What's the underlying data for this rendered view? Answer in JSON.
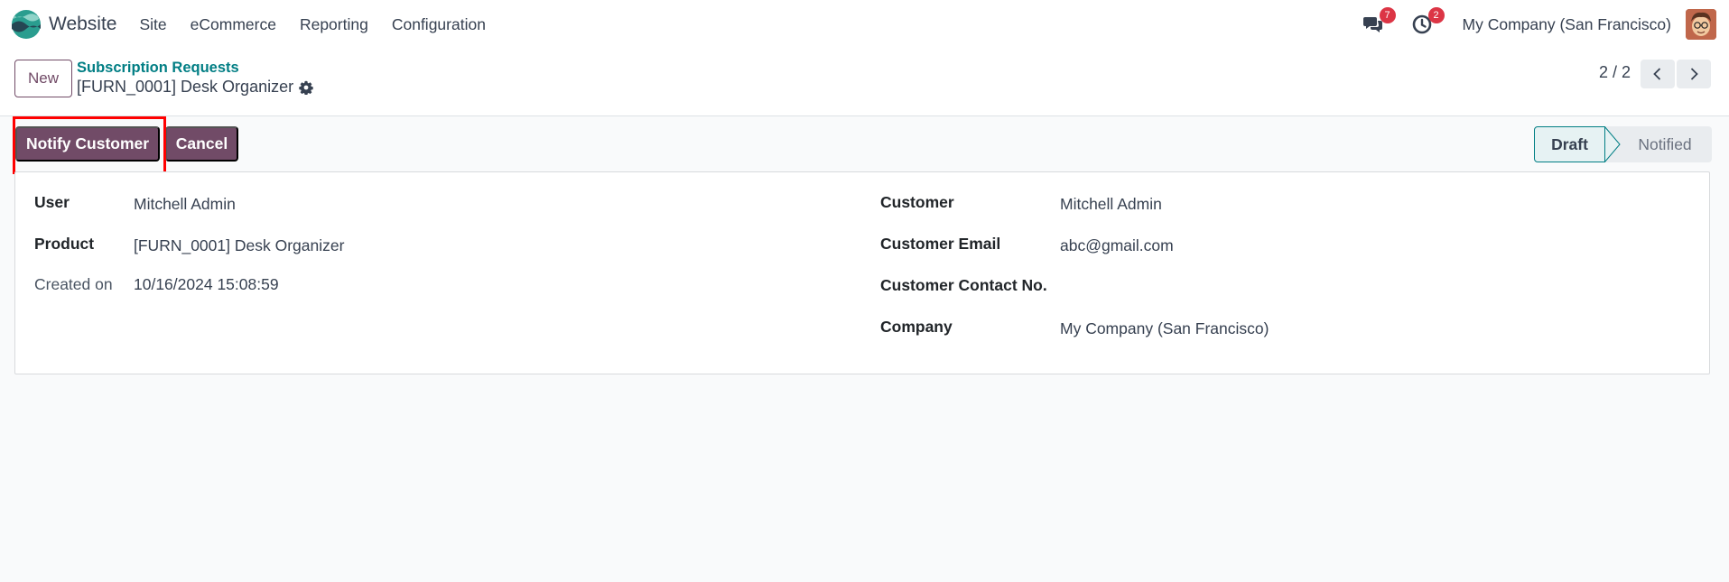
{
  "navbar": {
    "app_name": "Website",
    "menu": [
      "Site",
      "eCommerce",
      "Reporting",
      "Configuration"
    ],
    "messages_count": "7",
    "activities_count": "2",
    "company": "My Company (San Francisco)"
  },
  "control_panel": {
    "new_label": "New",
    "breadcrumb": "Subscription Requests",
    "record_title": "[FURN_0001] Desk Organizer",
    "pager": "2 / 2"
  },
  "statusbar": {
    "notify_label": "Notify Customer",
    "cancel_label": "Cancel",
    "stages": [
      "Draft",
      "Notified"
    ],
    "active_stage": "Draft"
  },
  "form": {
    "left": [
      {
        "label": "User",
        "value": "Mitchell Admin"
      },
      {
        "label": "Product",
        "value": "[FURN_0001] Desk Organizer"
      },
      {
        "label": "Created on",
        "value": "10/16/2024 15:08:59"
      }
    ],
    "right": [
      {
        "label": "Customer",
        "value": "Mitchell Admin"
      },
      {
        "label": "Customer Email",
        "value": "abc@gmail.com"
      },
      {
        "label": "Customer Contact No.",
        "value": ""
      },
      {
        "label": "Company",
        "value": "My Company (San Francisco)"
      }
    ]
  },
  "colors": {
    "primary": "#714b67",
    "link": "#017e84",
    "badge": "#dc3545",
    "highlight": "#ff0000"
  }
}
